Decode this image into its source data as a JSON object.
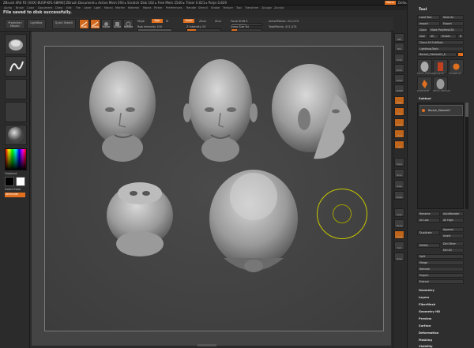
{
  "titlebar": {
    "title": "ZBrush 4R4 P2 [XXX] BUSP-KPL-S8MAI]  ZBrush Document  ▸ Active Mem 593 ▸ Scratch Disk 102 ▸ Free Mem 2540 ▸ Timer 0.021 ▸ Polys 0.829",
    "menu_button": "Menu",
    "script_label": "DefaultZScript"
  },
  "menubar": [
    "Alpha",
    "Brush",
    "Color",
    "Document",
    "Draw",
    "Edit",
    "File",
    "Layer",
    "Light",
    "Macro",
    "Marker",
    "Material",
    "Movie",
    "Picker",
    "Preferences",
    "Render",
    "Stencil",
    "Stroke",
    "Texture",
    "Tool",
    "Transform",
    "Zplugin",
    "Zscript"
  ],
  "status_message": "File saved to disk successfully.",
  "toolbar": {
    "projection_master": "Projection Master",
    "lightbox": "LightBox",
    "quick_sketch": "Quick Sketch",
    "edit": "Edit",
    "draw": "Draw",
    "move": "Move",
    "scale": "Scale",
    "rotate": "Rotate",
    "mrgb": "Mrgb",
    "rgb": "Rgb",
    "m": "M",
    "rgb_label": "Rgb",
    "rgb_intensity": "Rgb Intensity 100",
    "zadd": "Zadd",
    "zsub": "Zsub",
    "zcut": "Zcut",
    "z_intensity": "Z Intensity 25",
    "focal_shift": "Focal Shift 0",
    "draw_size": "Draw Size 64",
    "active_points": "ActivePoints: 411,074",
    "total_points": "TotalPoints: 411,074"
  },
  "left_shelf": {
    "gradient": "Gradient",
    "switch_color": "SwitchColor",
    "alternate": "Alternate"
  },
  "right_icons": [
    "BPR",
    "SPix",
    "Scroll",
    "Zoom",
    "Actual",
    "AAHalf",
    "Persp",
    "Floor",
    "Local",
    "L.Sym",
    "Xyz",
    "Frame",
    "Move",
    "Scale",
    "Rotate",
    "PolyF",
    "Transp",
    "Ghost",
    "Solo",
    "Xpose"
  ],
  "right_panel": {
    "title": "Tool",
    "load_tool": "Load Tool",
    "save_as": "Save As",
    "import": "Import",
    "export": "Export",
    "clone": "Clone",
    "make_polymesh": "Make PolyMesh3D",
    "goz": "GoZ",
    "all": "All",
    "visible": "Visible",
    "r": "R",
    "clone_all_subtools": "Clone All SubTools",
    "lightbox_tools": "Lightbox▸Tools",
    "current_tool": "Barack_Obama01_A",
    "thumb_labels": [
      "Barack_Obama01",
      "Cylinder3D",
      "SimpleBrush",
      "PolyMesh3D",
      "Barack_Obama01"
    ],
    "subtool": "Subtool",
    "subtool_item": "Barack_Obama01",
    "rename": "Rename",
    "autoreorder": "AutoReorder",
    "all_low": "All Low",
    "all_high": "All High",
    "duplicate": "Duplicate",
    "append": "Append",
    "insert": "Insert",
    "delete": "Delete",
    "del_other": "Del Other",
    "del_all": "Del All",
    "split": "Split",
    "merge": "Merge",
    "remesh": "Remesh",
    "project": "Project",
    "extract": "Extract",
    "sections": [
      "Geometry",
      "Layers",
      "FiberMesh",
      "Geometry HD",
      "Preview",
      "Surface",
      "Deformation",
      "Masking",
      "Visibility"
    ]
  },
  "colors": {
    "accent": "#e07020",
    "viewport_bg": "#444444",
    "ring": "#c8c800"
  }
}
